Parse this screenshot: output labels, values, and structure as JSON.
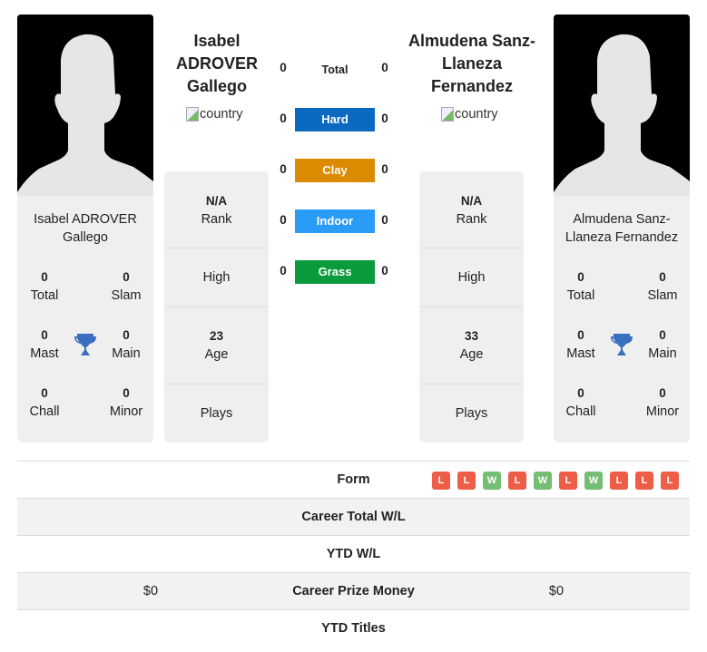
{
  "player_left": {
    "name_heading": "Isabel ADROVER Gallego",
    "name_lines": [
      "Isabel",
      "ADROVER",
      "Gallego"
    ],
    "card_name": "Isabel ADROVER Gallego",
    "flag_alt": "country",
    "titles": {
      "total": {
        "value": "0",
        "label": "Total"
      },
      "slam": {
        "value": "0",
        "label": "Slam"
      },
      "mast": {
        "value": "0",
        "label": "Mast"
      },
      "main": {
        "value": "0",
        "label": "Main"
      },
      "chall": {
        "value": "0",
        "label": "Chall"
      },
      "minor": {
        "value": "0",
        "label": "Minor"
      }
    },
    "stats": {
      "rank": {
        "value": "N/A",
        "label": "Rank"
      },
      "high": {
        "value": "",
        "label": "High"
      },
      "age": {
        "value": "23",
        "label": "Age"
      },
      "plays": {
        "value": "",
        "label": "Plays"
      }
    }
  },
  "player_right": {
    "name_heading": "Almudena Sanz-Llaneza Fernandez",
    "name_lines": [
      "Almudena Sanz-",
      "Llaneza",
      "Fernandez"
    ],
    "card_name": "Almudena Sanz-Llaneza Fernandez",
    "flag_alt": "country",
    "titles": {
      "total": {
        "value": "0",
        "label": "Total"
      },
      "slam": {
        "value": "0",
        "label": "Slam"
      },
      "mast": {
        "value": "0",
        "label": "Mast"
      },
      "main": {
        "value": "0",
        "label": "Main"
      },
      "chall": {
        "value": "0",
        "label": "Chall"
      },
      "minor": {
        "value": "0",
        "label": "Minor"
      }
    },
    "stats": {
      "rank": {
        "value": "N/A",
        "label": "Rank"
      },
      "high": {
        "value": "",
        "label": "High"
      },
      "age": {
        "value": "33",
        "label": "Age"
      },
      "plays": {
        "value": "",
        "label": "Plays"
      }
    }
  },
  "h2h": [
    {
      "label": "Total",
      "left": "0",
      "right": "0",
      "color": ""
    },
    {
      "label": "Hard",
      "left": "0",
      "right": "0",
      "color": "#0a6abf"
    },
    {
      "label": "Clay",
      "left": "0",
      "right": "0",
      "color": "#dc8a00"
    },
    {
      "label": "Indoor",
      "left": "0",
      "right": "0",
      "color": "#2a9cf5"
    },
    {
      "label": "Grass",
      "left": "0",
      "right": "0",
      "color": "#0b9a3c"
    }
  ],
  "bottom": {
    "form_label": "Form",
    "form": [
      "L",
      "L",
      "W",
      "L",
      "W",
      "L",
      "W",
      "L",
      "L",
      "L"
    ],
    "rows": [
      {
        "label": "Career Total W/L",
        "left": "",
        "right": ""
      },
      {
        "label": "YTD W/L",
        "left": "",
        "right": ""
      },
      {
        "label": "Career Prize Money",
        "left": "$0",
        "right": "$0"
      },
      {
        "label": "YTD Titles",
        "left": "",
        "right": ""
      }
    ]
  },
  "colors": {
    "win": "#74bd72",
    "loss": "#ee5d46",
    "trophy": "#3a6fbf",
    "card_bg": "#efefef"
  }
}
